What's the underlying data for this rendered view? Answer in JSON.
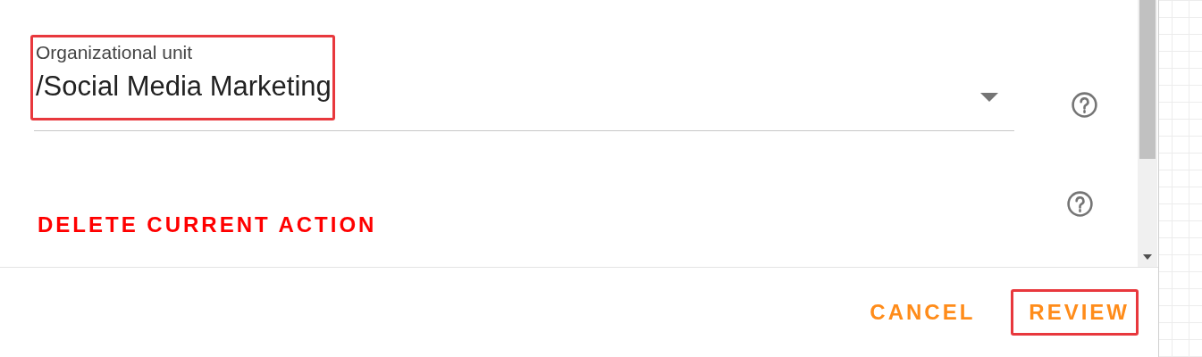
{
  "form": {
    "fields": [
      {
        "kind": "select",
        "label": "Organizational unit",
        "value": "/Social Media Marketing",
        "highlighted": true,
        "help": true
      },
      {
        "kind": "action",
        "label": "DELETE CURRENT ACTION",
        "help": true
      }
    ]
  },
  "footer": {
    "buttons": [
      {
        "label": "CANCEL",
        "highlighted": false
      },
      {
        "label": "REVIEW",
        "highlighted": true
      }
    ]
  }
}
